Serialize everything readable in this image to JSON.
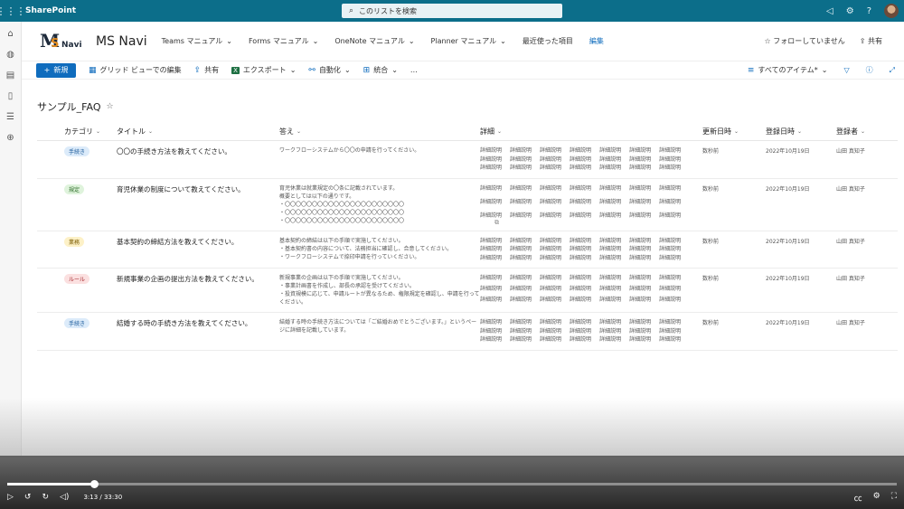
{
  "suitebar": {
    "app_name": "SharePoint",
    "search_placeholder": "このリストを検索"
  },
  "site": {
    "logo_text": {
      "m": "M",
      "s": "S",
      "navi": "Navi"
    },
    "name": "MS Navi",
    "nav": [
      "Teams マニュアル",
      "Forms マニュアル",
      "OneNote マニュアル",
      "Planner マニュアル",
      "最近使った項目"
    ],
    "edit_label": "編集",
    "follow_label": "フォローしていません",
    "share_label": "共有"
  },
  "commands": {
    "new_label": "新規",
    "grid_edit": "グリッド ビューでの編集",
    "share": "共有",
    "export": "エクスポート",
    "automate": "自動化",
    "integrate": "統合",
    "more": "…",
    "view": "すべてのアイテム*"
  },
  "list": {
    "title": "サンプル_FAQ",
    "columns": [
      "カテゴリ",
      "タイトル",
      "答え",
      "詳細",
      "更新日時",
      "登録日時",
      "登録者"
    ],
    "detail_word": "詳細説明",
    "rows": [
      {
        "category": "手続き",
        "color": "#dcebfa",
        "text_color": "#1a5a9a",
        "title": "〇〇の手続き方法を教えてください。",
        "answer": "ワークフローシステムから〇〇の申請を行ってください。",
        "updated": "数秒前",
        "created": "2022年10月19日",
        "author": "山田 真知子"
      },
      {
        "category": "規定",
        "color": "#dff3dc",
        "text_color": "#2f6e2a",
        "title": "育児休業の制度について教えてください。",
        "answer": "育児休業は就業規定の〇条に記載されています。\n概要としては以下の通りです。\n・〇〇〇〇〇〇〇〇〇〇〇〇〇〇〇〇〇〇〇〇〇〇\n・〇〇〇〇〇〇〇〇〇〇〇〇〇〇〇〇〇〇〇〇〇〇\n・〇〇〇〇〇〇〇〇〇〇〇〇〇〇〇〇〇〇〇〇〇〇",
        "updated": "数秒前",
        "created": "2022年10月19日",
        "author": "山田 真知子"
      },
      {
        "category": "業務",
        "color": "#fdf1c7",
        "text_color": "#7a5a00",
        "title": "基本契約の締結方法を教えてください。",
        "answer": "基本契約の締結は以下の手順で実施してください。\n・基本契約書の内容について、法務担当に確認し、合意してください。\n・ワークフローシステムで捺印申請を行っていください。",
        "updated": "数秒前",
        "created": "2022年10月19日",
        "author": "山田 真知子"
      },
      {
        "category": "ルール",
        "color": "#fbe0e0",
        "text_color": "#a4262c",
        "title": "新規事業の企画の提出方法を教えてください。",
        "answer": "新規事業の企画は以下の手順で実施してください。\n・事業計画書を作成し、部長の承認を受けてください。\n・投資規模に応じて、申請ルートが異なるため、権限規定を確認し、申請を行ってください。",
        "updated": "数秒前",
        "created": "2022年10月19日",
        "author": "山田 真知子"
      },
      {
        "category": "手続き",
        "color": "#dcebfa",
        "text_color": "#1a5a9a",
        "title": "結婚する時の手続き方法を教えてください。",
        "answer": "結婚する時の手続き方法については「ご結婚おめでとうございます。」というページに詳細を記載しています。",
        "updated": "数秒前",
        "created": "2022年10月19日",
        "author": "山田 真知子"
      }
    ]
  },
  "video": {
    "time": "3:13 / 33:30",
    "progress": 0.098
  }
}
